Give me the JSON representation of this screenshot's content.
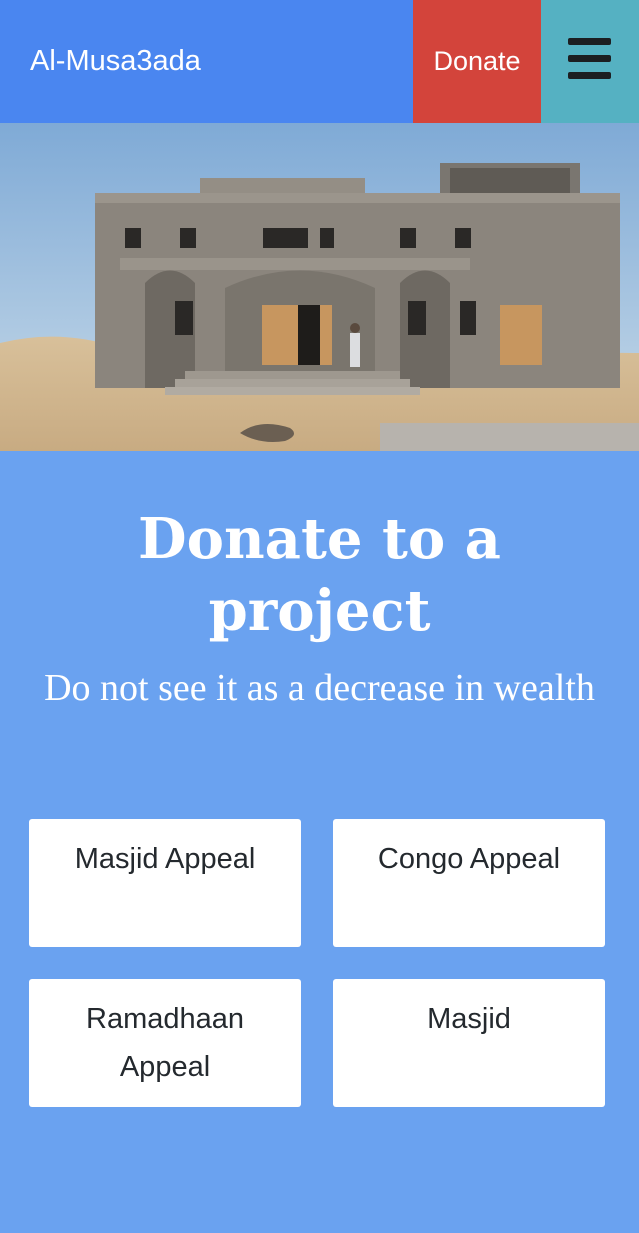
{
  "navbar": {
    "brand": "Al-Musa3ada",
    "donate_label": "Donate",
    "menu_icon": "hamburger-icon",
    "colors": {
      "navbar": "#4a86f0",
      "donate": "#d3443b",
      "menu": "#55b1c2"
    }
  },
  "hero": {
    "image": "mosque-under-construction"
  },
  "section": {
    "title": "Donate to a project",
    "subtitle": "Do not see it as a decrease in wealth",
    "background": "#6aa2f0"
  },
  "projects": [
    {
      "label": "Masjid Appeal"
    },
    {
      "label": "Congo Appeal"
    },
    {
      "label": "Ramadhaan Appeal"
    },
    {
      "label": "Masjid"
    }
  ]
}
